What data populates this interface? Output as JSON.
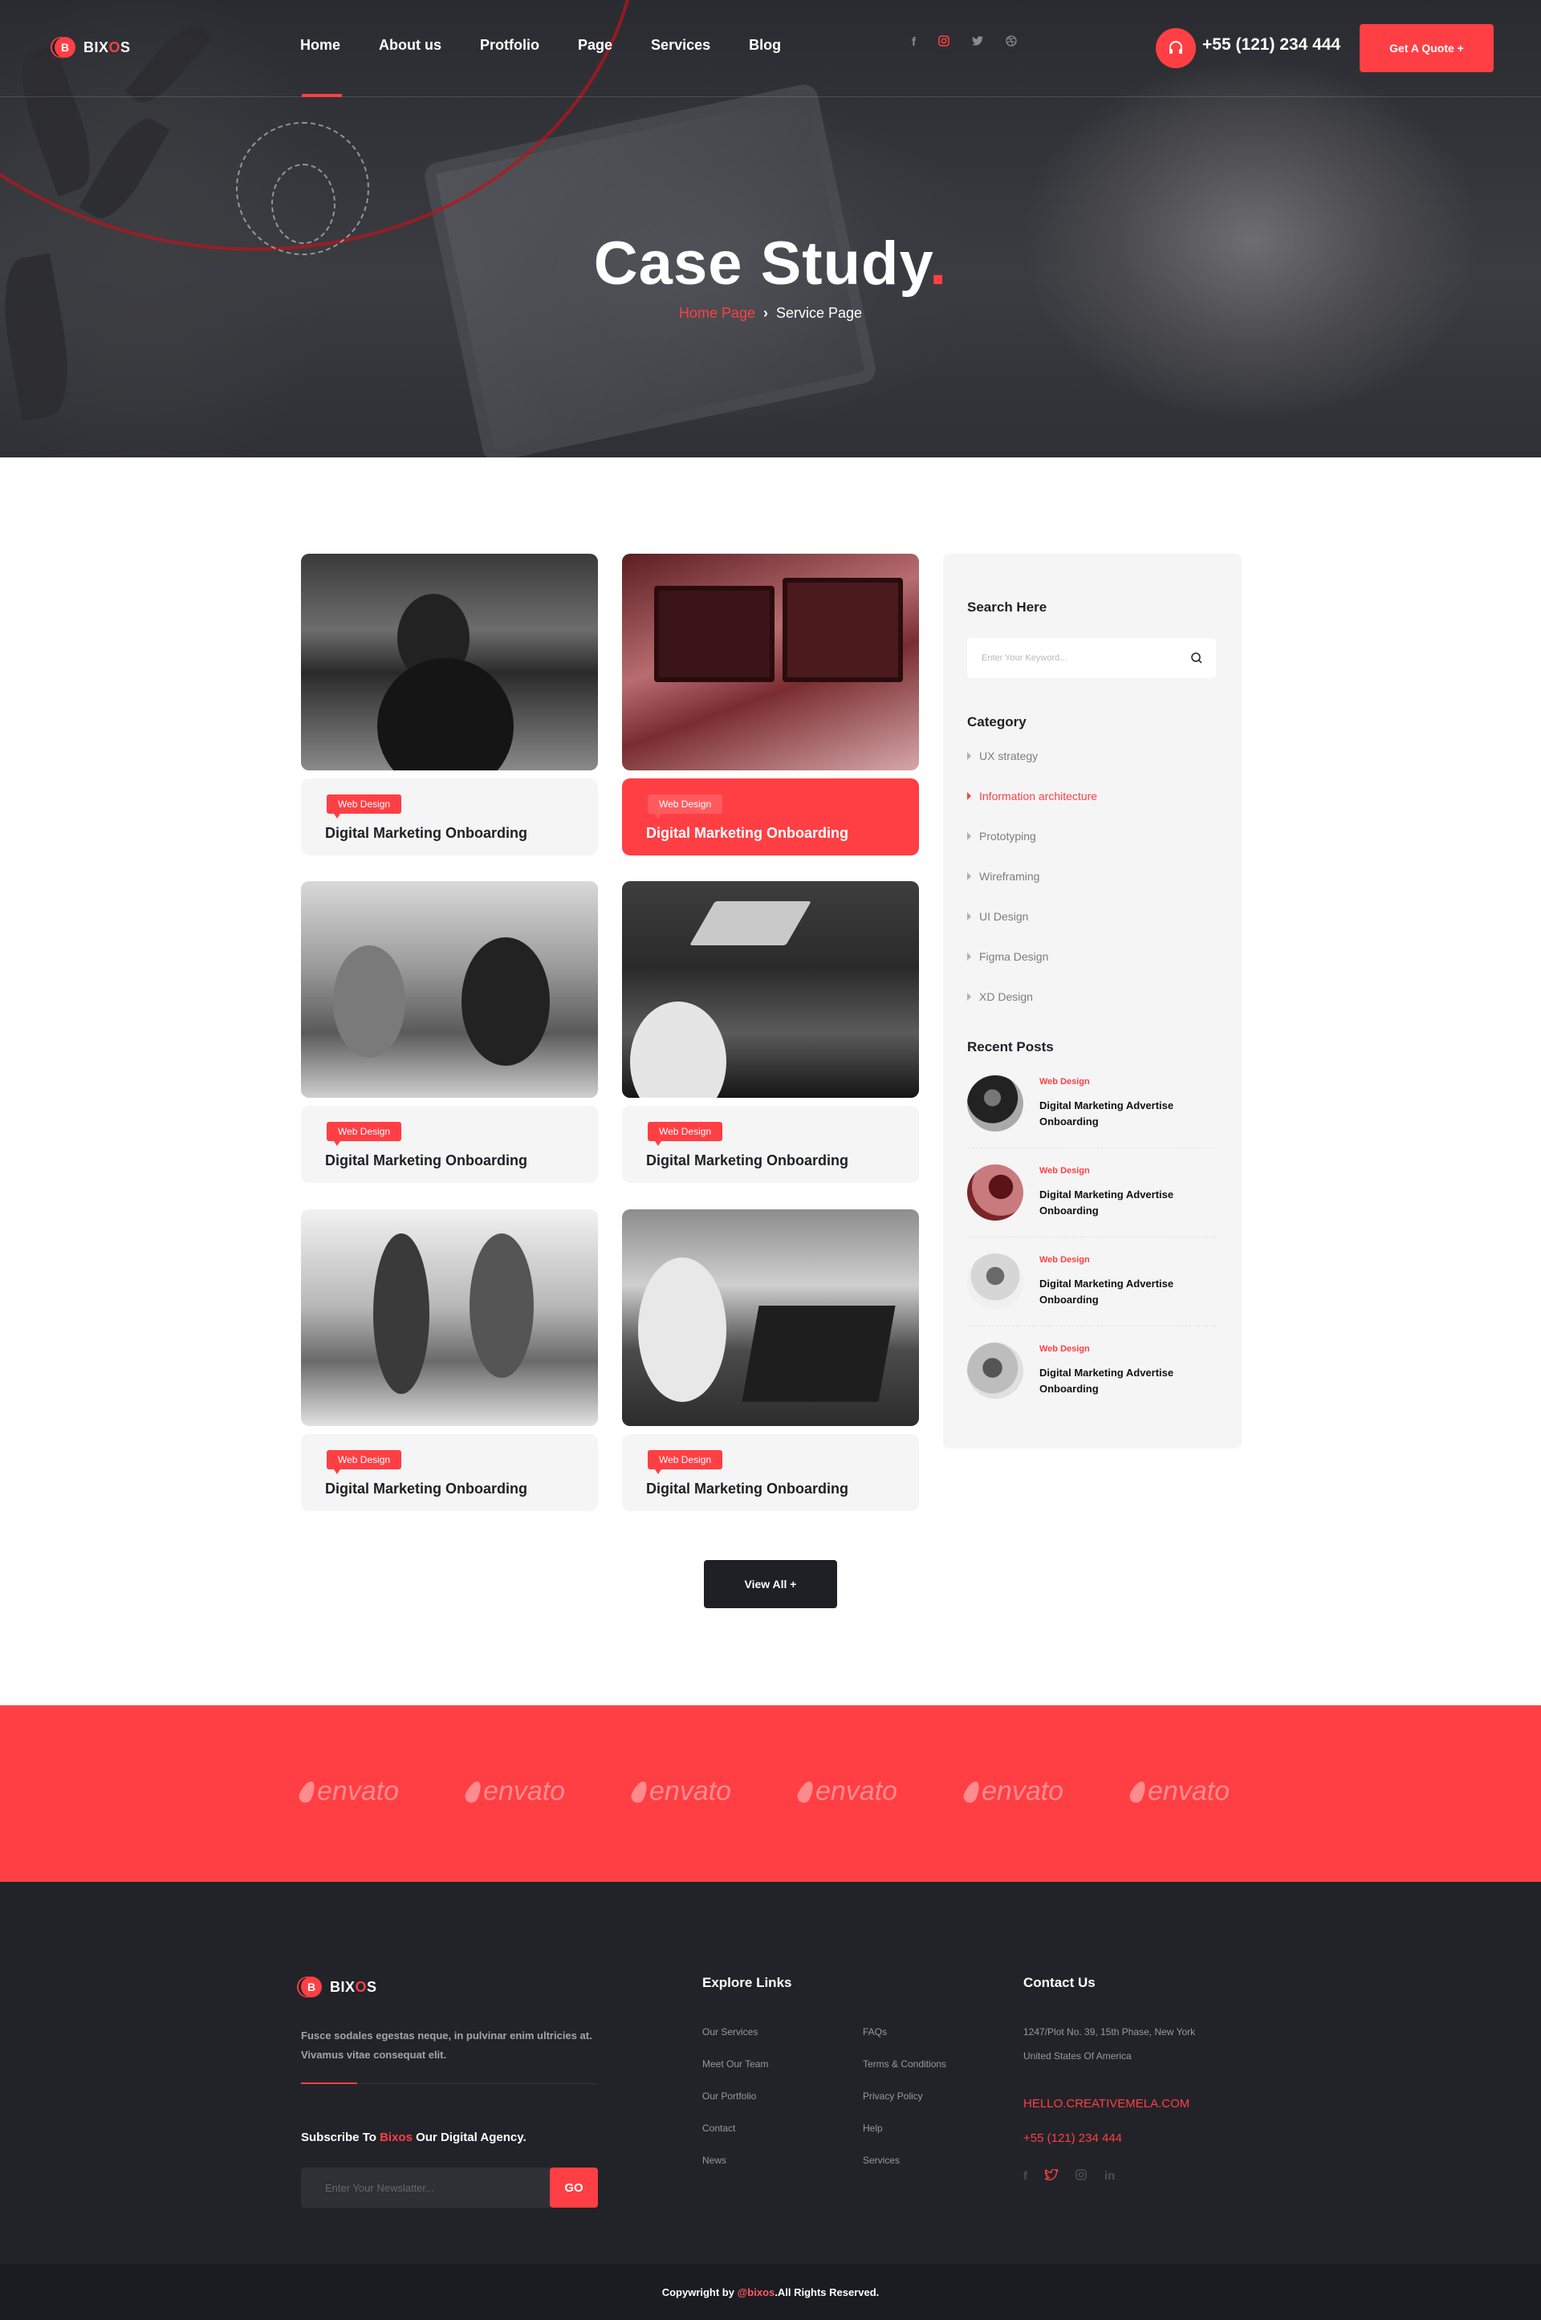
{
  "brand": {
    "name_prefix": "BIX",
    "name_accent": "O",
    "name_suffix": "S",
    "mark": "B",
    "accent_color": "#ff3f44"
  },
  "nav": {
    "items": [
      {
        "label": "Home",
        "active": true
      },
      {
        "label": "About us"
      },
      {
        "label": "Protfolio"
      },
      {
        "label": "Page"
      },
      {
        "label": "Services"
      },
      {
        "label": "Blog"
      }
    ],
    "social_icons": [
      "facebook-icon",
      "instagram-icon",
      "twitter-icon",
      "dribbble-icon"
    ],
    "phone_icon": "headphones-icon",
    "phone": "+55 (121) 234 444",
    "cta": "Get A Quote +"
  },
  "hero": {
    "title": "Case Study",
    "title_dot": ".",
    "breadcrumb": {
      "home": "Home Page",
      "separator": "›",
      "current": "Service Page"
    }
  },
  "cases": [
    {
      "tag": "Web Design",
      "title": "Digital Marketing Onboarding",
      "active": false
    },
    {
      "tag": "Web Design",
      "title": "Digital Marketing Onboarding",
      "active": true
    },
    {
      "tag": "Web Design",
      "title": "Digital Marketing Onboarding",
      "active": false
    },
    {
      "tag": "Web Design",
      "title": "Digital Marketing Onboarding",
      "active": false
    },
    {
      "tag": "Web Design",
      "title": "Digital Marketing Onboarding",
      "active": false
    },
    {
      "tag": "Web Design",
      "title": "Digital Marketing Onboarding",
      "active": false
    }
  ],
  "view_all": "View All +",
  "sidebar": {
    "search_heading": "Search Here",
    "search_placeholder": "Enter Your Keyword...",
    "category_heading": "Category",
    "categories": [
      {
        "label": "UX strategy"
      },
      {
        "label": "Information architecture",
        "active": true
      },
      {
        "label": "Prototyping"
      },
      {
        "label": "Wireframing"
      },
      {
        "label": "UI Design"
      },
      {
        "label": "Figma Design"
      },
      {
        "label": "XD Design"
      }
    ],
    "recent_heading": "Recent Posts",
    "recent_posts": [
      {
        "tag": "Web Design",
        "title": "Digital Marketing Advertise Onboarding"
      },
      {
        "tag": "Web Design",
        "title": "Digital Marketing Advertise Onboarding"
      },
      {
        "tag": "Web Design",
        "title": "Digital Marketing Advertise Onboarding"
      },
      {
        "tag": "Web Design",
        "title": "Digital Marketing Advertise Onboarding"
      }
    ]
  },
  "brands": [
    "envato",
    "envato",
    "envato",
    "envato",
    "envato",
    "envato"
  ],
  "footer": {
    "description": "Fusce sodales egestas neque, in pulvinar enim ultricies at. Vivamus vitae consequat elit.",
    "subscribe_prefix": "Subscribe To ",
    "subscribe_accent": "Bixos",
    "subscribe_suffix": " Our Digital Agency.",
    "newsletter_placeholder": "Enter Your Newslatter...",
    "go": "GO",
    "explore_heading": "Explore Links",
    "links_col1": [
      "Our Services",
      "Meet Our Team",
      "Our Portfolio",
      "Contact",
      "News"
    ],
    "links_col2": [
      "FAQs",
      "Terms & Conditions",
      "Privacy Policy",
      "Help",
      "Services"
    ],
    "contact_heading": "Contact Us",
    "address_line1": "1247/Plot No. 39, 15th Phase, New York",
    "address_line2": "United States Of America",
    "email": "HELLO.CREATIVEMELA.COM",
    "phone": "+55 (121) 234 444",
    "social_icons": [
      "facebook-icon",
      "twitter-icon",
      "instagram-icon",
      "linkedin-icon"
    ],
    "copyright_prefix": "Copywright by ",
    "copyright_handle": "@bixos",
    "copyright_suffix": ".All Rights Reserved."
  }
}
